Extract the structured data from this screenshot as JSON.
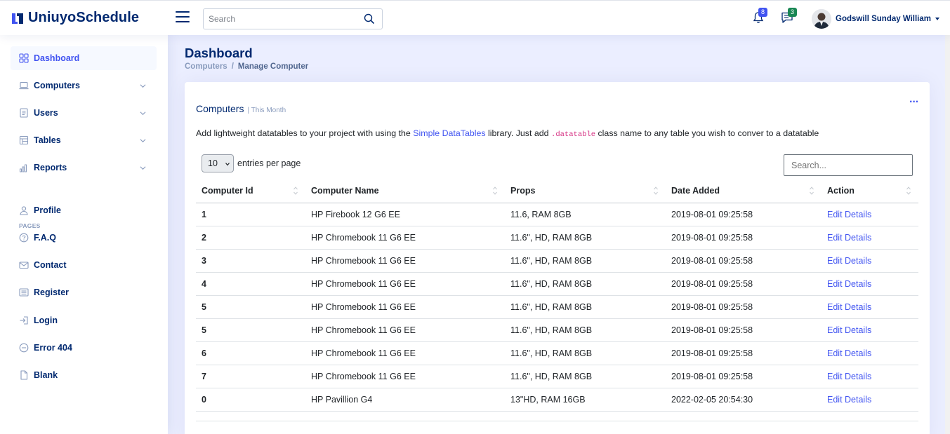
{
  "app": {
    "name": "UniuyoSchedule"
  },
  "header": {
    "search_placeholder": "Search",
    "notifications_count": "8",
    "messages_count": "3",
    "user_name": "Godswill Sunday William"
  },
  "sidebar": {
    "items": [
      {
        "label": "Dashboard",
        "icon": "grid-icon",
        "active": true
      },
      {
        "label": "Computers",
        "icon": "laptop-icon",
        "chevron": true
      },
      {
        "label": "Users",
        "icon": "file-list-icon",
        "chevron": true
      },
      {
        "label": "Tables",
        "icon": "table-icon",
        "chevron": true
      },
      {
        "label": "Reports",
        "icon": "bar-chart-icon",
        "chevron": true
      }
    ],
    "pages_heading": "PAGES",
    "pages": [
      {
        "label": "Profile",
        "icon": "person-icon"
      },
      {
        "label": "F.A.Q",
        "icon": "question-circle-icon"
      },
      {
        "label": "Contact",
        "icon": "envelope-icon"
      },
      {
        "label": "Register",
        "icon": "card-list-icon"
      },
      {
        "label": "Login",
        "icon": "login-icon"
      },
      {
        "label": "Error 404",
        "icon": "dash-circle-icon"
      },
      {
        "label": "Blank",
        "icon": "file-icon"
      }
    ]
  },
  "page": {
    "title": "Dashboard",
    "breadcrumb": [
      "Computers",
      "Manage Computer"
    ]
  },
  "card": {
    "title": "Computers",
    "subtitle": "| This Month",
    "menu_icon": "three-dots-icon",
    "description": {
      "before": "Add lightweight datatables to your project with using the ",
      "link": "Simple DataTables",
      "middle": " library. Just add ",
      "code": ".datatable",
      "after": " class name to any table you wish to conver to a datatable"
    },
    "per_page_value": "10",
    "per_page_label": "entries per page",
    "search_placeholder": "Search...",
    "columns": [
      "Computer Id",
      "Computer Name",
      "Props",
      "Date Added",
      "Action"
    ],
    "rows": [
      {
        "id": "1",
        "name": "HP Firebook 12 G6 EE",
        "props": "11.6, RAM 8GB",
        "date": "2019-08-01 09:25:58",
        "action": "Edit Details"
      },
      {
        "id": "2",
        "name": "HP Chromebook 11 G6 EE",
        "props": "11.6\", HD, RAM 8GB",
        "date": "2019-08-01 09:25:58",
        "action": "Edit Details"
      },
      {
        "id": "3",
        "name": "HP Chromebook 11 G6 EE",
        "props": "11.6\", HD, RAM 8GB",
        "date": "2019-08-01 09:25:58",
        "action": "Edit Details"
      },
      {
        "id": "4",
        "name": "HP Chromebook 11 G6 EE",
        "props": "11.6\", HD, RAM 8GB",
        "date": "2019-08-01 09:25:58",
        "action": "Edit Details"
      },
      {
        "id": "5",
        "name": "HP Chromebook 11 G6 EE",
        "props": "11.6\", HD, RAM 8GB",
        "date": "2019-08-01 09:25:58",
        "action": "Edit Details"
      },
      {
        "id": "5",
        "name": "HP Chromebook 11 G6 EE",
        "props": "11.6\", HD, RAM 8GB",
        "date": "2019-08-01 09:25:58",
        "action": "Edit Details"
      },
      {
        "id": "6",
        "name": "HP Chromebook 11 G6 EE",
        "props": "11.6\", HD, RAM 8GB",
        "date": "2019-08-01 09:25:58",
        "action": "Edit Details"
      },
      {
        "id": "7",
        "name": "HP Chromebook 11 G6 EE",
        "props": "11.6\", HD, RAM 8GB",
        "date": "2019-08-01 09:25:58",
        "action": "Edit Details"
      },
      {
        "id": "0",
        "name": "HP Pavillion G4",
        "props": "13\"HD, RAM 16GB",
        "date": "2022-02-05 20:54:30",
        "action": "Edit Details"
      }
    ]
  },
  "colors": {
    "brand": "#012970",
    "accent": "#4154f1",
    "main_bg": "#ebeeff",
    "badge_green": "#198754"
  }
}
